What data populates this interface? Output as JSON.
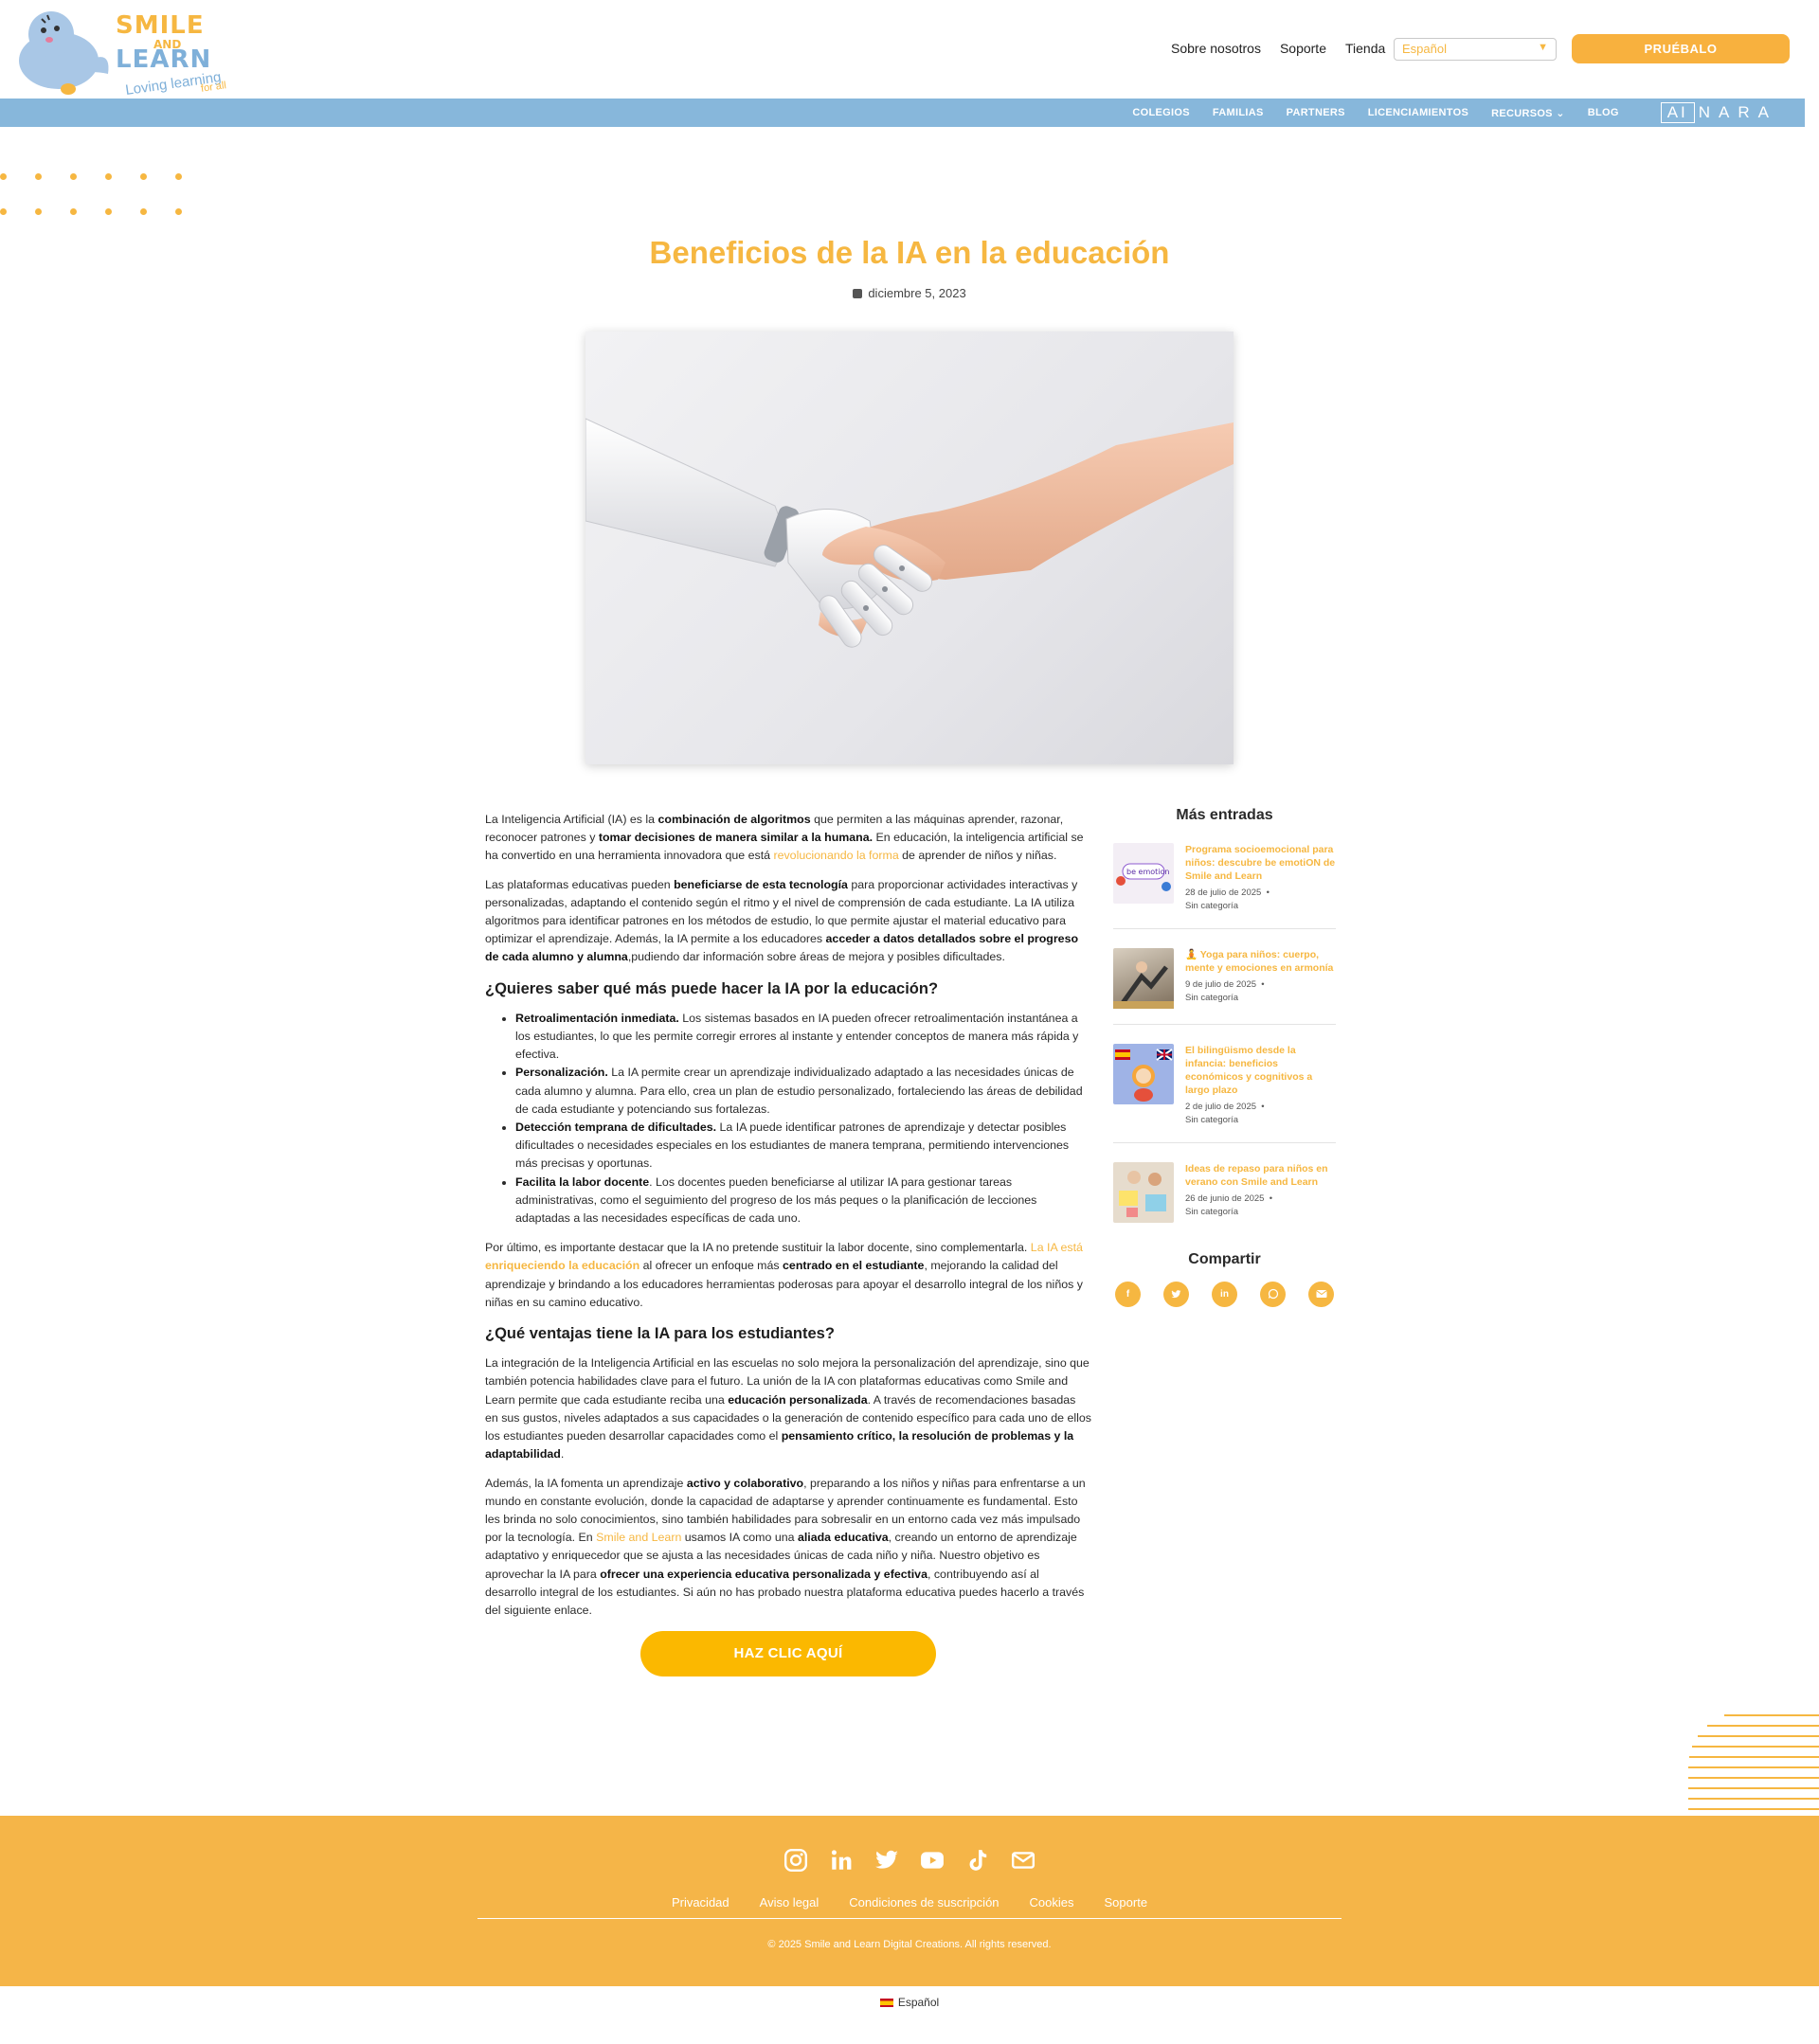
{
  "header": {
    "logo": {
      "line1": "SMILE",
      "and": "AND",
      "line2": "LEARN",
      "tagline": "Loving learning",
      "tagline2": "for all"
    },
    "top_nav": [
      "Sobre nosotros",
      "Soporte",
      "Tienda"
    ],
    "language_select": {
      "value": "Español"
    },
    "try_button": "PRUÉBALO"
  },
  "main_nav": {
    "items": [
      "COLEGIOS",
      "FAMILIAS",
      "PARTNERS",
      "LICENCIAMIENTOS",
      "RECURSOS",
      "BLOG"
    ],
    "brand": {
      "ai": "AI",
      "nara": "NARA"
    }
  },
  "post": {
    "title": "Beneficios de la IA en la educación",
    "date": "diciembre 5, 2023",
    "hero_alt": "Robot hand shaking a human hand"
  },
  "article": {
    "p1": [
      {
        "t": "La Inteligencia Artificial (IA) es la "
      },
      {
        "t": "combinación de algoritmos",
        "b": true
      },
      {
        "t": " que permiten a las máquinas aprender, razonar, reconocer patrones y "
      },
      {
        "t": "tomar decisiones de manera similar a la humana.",
        "b": true
      },
      {
        "t": " En educación, la inteligencia artificial se ha convertido en una herramienta innovadora que está "
      },
      {
        "t": "revolucionando la forma",
        "l": true
      },
      {
        "t": " de aprender de niños y niñas."
      }
    ],
    "p2": [
      {
        "t": "Las plataformas educativas pueden "
      },
      {
        "t": "beneficiarse de esta tecnología",
        "b": true
      },
      {
        "t": " para proporcionar actividades interactivas y personalizadas, adaptando el contenido según el ritmo y el nivel de comprensión de cada estudiante. La IA utiliza algoritmos para identificar patrones en los métodos de estudio, lo que permite ajustar el material educativo para optimizar el aprendizaje. Además, la IA permite a los educadores "
      },
      {
        "t": "acceder a datos detallados sobre el progreso de cada alumno y alumna",
        "b": true
      },
      {
        "t": ",pudiendo dar información sobre áreas de mejora y posibles dificultades."
      }
    ],
    "h2_1": "¿Quieres saber qué más puede hacer la IA por la educación?",
    "list": [
      [
        {
          "t": "Retroalimentación inmediata.",
          "b": true
        },
        {
          "t": " Los sistemas basados en IA pueden ofrecer retroalimentación instantánea a los estudiantes, lo que les permite corregir errores al instante y entender conceptos de manera más rápida y efectiva."
        }
      ],
      [
        {
          "t": "Personalización.",
          "b": true
        },
        {
          "t": " La IA permite crear un aprendizaje individualizado adaptado a las necesidades únicas de cada alumno y alumna. Para ello, crea un plan de estudio personalizado, fortaleciendo las áreas de debilidad de cada estudiante y potenciando sus fortalezas."
        }
      ],
      [
        {
          "t": "Detección temprana de dificultades.",
          "b": true
        },
        {
          "t": " La IA puede identificar patrones de aprendizaje y detectar posibles dificultades o necesidades especiales en los estudiantes de manera temprana, permitiendo intervenciones más precisas y oportunas."
        }
      ],
      [
        {
          "t": "Facilita la labor docente",
          "b": true
        },
        {
          "t": ". Los docentes pueden beneficiarse al utilizar IA para gestionar tareas administrativas, como el seguimiento del progreso de los más peques o la planificación de lecciones adaptadas a las necesidades específicas de cada uno."
        }
      ]
    ],
    "p3": [
      {
        "t": "Por último, es importante destacar que la IA no pretende sustituir la labor docente, sino complementarla. "
      },
      {
        "t": "La IA está ",
        "l": true
      },
      {
        "t": "enriqueciendo la educación",
        "l": true,
        "b": true
      },
      {
        "t": " al ofrecer un enfoque más "
      },
      {
        "t": "centrado en el estudiante",
        "b": true
      },
      {
        "t": ", mejorando la calidad del aprendizaje y brindando a los educadores herramientas poderosas para apoyar el desarrollo integral de los niños y niñas en su camino educativo."
      }
    ],
    "h2_2": "¿Qué ventajas tiene la IA para los estudiantes?",
    "p4": [
      {
        "t": "La integración de la Inteligencia Artificial en las escuelas no solo mejora la personalización del aprendizaje, sino que también potencia habilidades clave para el futuro. La unión de la IA con plataformas educativas como Smile and Learn permite que cada estudiante reciba una "
      },
      {
        "t": "educación personalizada",
        "b": true
      },
      {
        "t": ". A través de recomendaciones basadas en sus gustos, niveles adaptados a sus capacidades o la generación de contenido específico para cada uno de ellos los estudiantes pueden desarrollar capacidades como el "
      },
      {
        "t": "pensamiento crítico, la resolución de problemas y la adaptabilidad",
        "b": true
      },
      {
        "t": "."
      }
    ],
    "p5": [
      {
        "t": "Además, la IA fomenta un aprendizaje "
      },
      {
        "t": "activo y colaborativo",
        "b": true
      },
      {
        "t": ", preparando a los niños y niñas para enfrentarse a un mundo en constante evolución, donde la capacidad de adaptarse y aprender continuamente es fundamental. Esto les brinda no solo conocimientos, sino también habilidades para sobresalir en un entorno cada vez más impulsado por la tecnología. En "
      },
      {
        "t": "Smile and Learn",
        "l": true
      },
      {
        "t": " usamos IA como una "
      },
      {
        "t": "aliada educativa",
        "b": true
      },
      {
        "t": ", creando un entorno de aprendizaje adaptativo y enriquecedor que se ajusta a las necesidades únicas de cada niño y niña. Nuestro objetivo es aprovechar la IA para "
      },
      {
        "t": "ofrecer una experiencia educativa personalizada y efectiva",
        "b": true
      },
      {
        "t": ", contribuyendo así al desarrollo integral de los estudiantes. Si aún no has probado nuestra plataforma educativa puedes hacerlo a través del siguiente enlace."
      }
    ],
    "cta": "HAZ CLIC AQUÍ"
  },
  "sidebar": {
    "title": "Más entradas",
    "posts": [
      {
        "title": "Programa socioemocional para niños: descubre be emotiON de Smile and Learn",
        "date": "28 de julio de 2025",
        "category": "Sin categoría",
        "thumb_color": "#f3eef5"
      },
      {
        "title": "🧘 Yoga para niños: cuerpo, mente y emociones en armonía",
        "date": "9 de julio de 2025",
        "category": "Sin categoría",
        "thumb_color": "#b9a88f"
      },
      {
        "title": "El bilingüismo desde la infancia: beneficios económicos y cognitivos a largo plazo",
        "date": "2 de julio de 2025",
        "category": "Sin categoría",
        "thumb_color": "#9fb3e6"
      },
      {
        "title": "Ideas de repaso para niños en verano con Smile and Learn",
        "date": "26 de junio de 2025",
        "category": "Sin categoría",
        "thumb_color": "#d8c9b4"
      }
    ],
    "share_title": "Compartir",
    "share": [
      "facebook-icon",
      "twitter-icon",
      "linkedin-icon",
      "whatsapp-icon",
      "email-icon"
    ]
  },
  "footer": {
    "icons": [
      "instagram-icon",
      "linkedin-icon",
      "twitter-icon",
      "youtube-icon",
      "tiktok-icon",
      "email-icon"
    ],
    "links": [
      "Privacidad",
      "Aviso legal",
      "Condiciones de suscripción",
      "Cookies",
      "Soporte"
    ],
    "copyright": "© 2025 Smile and Learn Digital Creations. All rights reserved.",
    "language": "Español"
  },
  "colors": {
    "accent": "#f6b741",
    "nav_blue": "#87b7db",
    "cta": "#fbb800",
    "footer": "#f5b548"
  }
}
